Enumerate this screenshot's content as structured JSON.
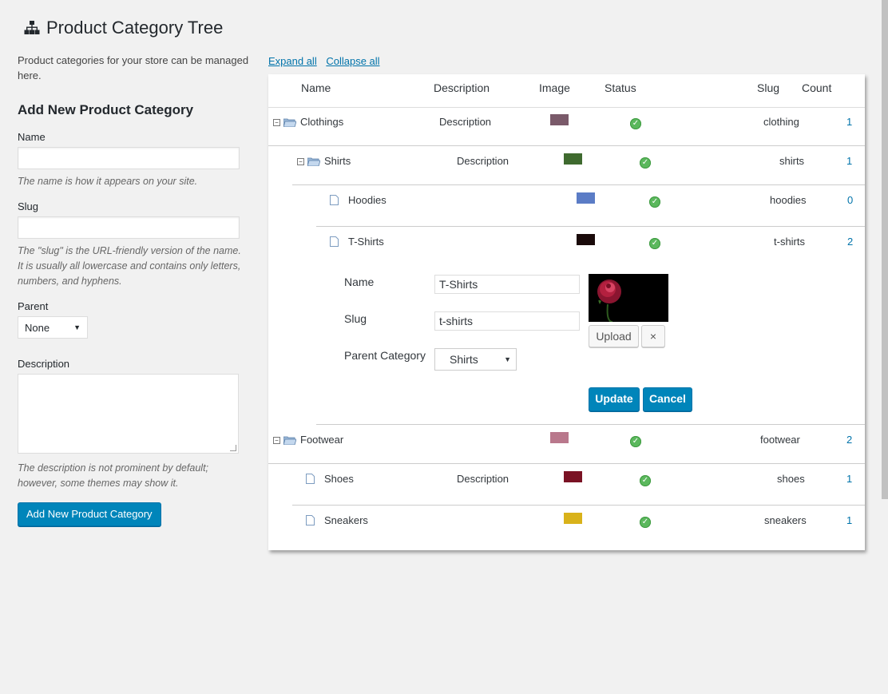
{
  "page": {
    "title": "Product Category Tree"
  },
  "form": {
    "intro": "Product categories for your store can be managed here.",
    "heading": "Add New Product Category",
    "name_label": "Name",
    "name_hint": "The name is how it appears on your site.",
    "slug_label": "Slug",
    "slug_hint": "The \"slug\" is the URL-friendly version of the name. It is usually all lowercase and contains only letters, numbers, and hyphens.",
    "parent_label": "Parent",
    "parent_value": "None",
    "description_label": "Description",
    "description_hint": "The description is not prominent by default; however, some themes may show it.",
    "submit_label": "Add New Product Category"
  },
  "tree": {
    "expand_all": "Expand all",
    "collapse_all": "Collapse all",
    "columns": {
      "name": "Name",
      "description": "Description",
      "image": "Image",
      "status": "Status",
      "slug": "Slug",
      "count": "Count"
    },
    "rows": [
      {
        "name": "Clothings",
        "description": "Description",
        "slug": "clothing",
        "count": "1",
        "thumb_color": "#7a5a6a"
      },
      {
        "name": "Shirts",
        "description": "Description",
        "slug": "shirts",
        "count": "1",
        "thumb_color": "#3f6a2f"
      },
      {
        "name": "Hoodies",
        "description": "",
        "slug": "hoodies",
        "count": "0",
        "thumb_color": "#5b7cc6"
      },
      {
        "name": "T-Shirts",
        "description": "",
        "slug": "t-shirts",
        "count": "2",
        "thumb_color": "#1a0a0a"
      },
      {
        "name": "Footwear",
        "description": "",
        "slug": "footwear",
        "count": "2",
        "thumb_color": "#b9788c"
      },
      {
        "name": "Shoes",
        "description": "Description",
        "slug": "shoes",
        "count": "1",
        "thumb_color": "#7a1224"
      },
      {
        "name": "Sneakers",
        "description": "",
        "slug": "sneakers",
        "count": "1",
        "thumb_color": "#d9b21a"
      }
    ],
    "edit": {
      "name_label": "Name",
      "name_value": "T-Shirts",
      "slug_label": "Slug",
      "slug_value": "t-shirts",
      "parent_label": "Parent Category",
      "parent_value": "Shirts",
      "upload_label": "Upload",
      "remove_label": "×",
      "update_label": "Update",
      "cancel_label": "Cancel"
    }
  },
  "colors": {
    "accent": "#0085ba",
    "status_ok": "#5bb85d",
    "link": "#0073aa"
  }
}
